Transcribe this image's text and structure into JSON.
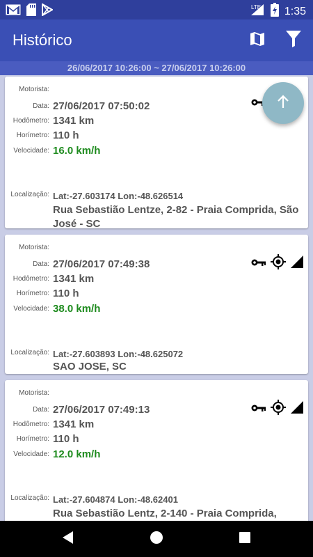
{
  "status_bar": {
    "time": "1:35",
    "network": "LTE",
    "icons": [
      "gmail-icon",
      "sd-card-icon",
      "play-store-icon",
      "signal-icon",
      "battery-icon"
    ]
  },
  "app_bar": {
    "title": "Histórico",
    "actions": [
      "map-icon",
      "filter-icon"
    ]
  },
  "date_range": "26/06/2017 10:26:00  ~  27/06/2017 10:26:00",
  "labels": {
    "driver": "Motorista:",
    "date": "Data:",
    "odometer": "Hodômetro:",
    "hourmeter": "Horímetro:",
    "speed": "Velocidade:",
    "location": "Localização:"
  },
  "records": [
    {
      "driver": "",
      "date": "27/06/2017 07:50:02",
      "odometer": "1341 km",
      "hourmeter": "110 h",
      "speed": "16.0 km/h",
      "coords": "Lat:-27.603174 Lon:-48.626514",
      "address": "Rua Sebastião Lentze, 2-82 - Praia Comprida, São José - SC",
      "icons": [
        "key-icon",
        "gps-icon",
        "signal-icon"
      ]
    },
    {
      "driver": "",
      "date": "27/06/2017 07:49:38",
      "odometer": "1341 km",
      "hourmeter": "110 h",
      "speed": "38.0 km/h",
      "coords": "Lat:-27.603893 Lon:-48.625072",
      "address": "SAO JOSE, SC",
      "icons": [
        "key-icon",
        "gps-icon",
        "signal-icon"
      ]
    },
    {
      "driver": "",
      "date": "27/06/2017 07:49:13",
      "odometer": "1341 km",
      "hourmeter": "110 h",
      "speed": "12.0 km/h",
      "coords": "Lat:-27.604874 Lon:-48.62401",
      "address": "Rua Sebastião Lentz, 2-140 - Praia Comprida,",
      "icons": [
        "key-icon",
        "gps-icon",
        "signal-icon"
      ]
    }
  ],
  "fab": {
    "icon": "arrow-up-icon"
  },
  "nav_bar": {
    "buttons": [
      "back-icon",
      "home-icon",
      "recents-icon"
    ]
  },
  "colors": {
    "primary": "#3a4fb5",
    "primary_dark": "#2f3f9c",
    "speed": "#1e8b1e",
    "background": "#c9cde6",
    "fab": "#8fb8c6"
  }
}
